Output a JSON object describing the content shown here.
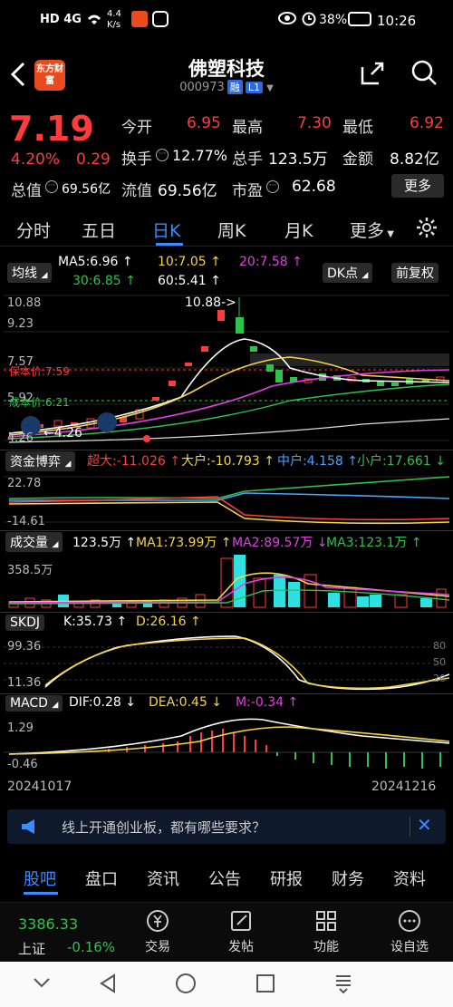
{
  "status": {
    "left_icons": "HD 4G",
    "speed": "4.4 K/s",
    "battery": "38%",
    "time": "10:26"
  },
  "header": {
    "logo_text": "东方财富",
    "title": "佛塑科技",
    "code": "000973",
    "badge1": "融",
    "badge2": "L1"
  },
  "quote": {
    "price": "7.19",
    "change_pct": "4.20%",
    "change": "0.29",
    "open_label": "今开",
    "open": "6.95",
    "high_label": "最高",
    "high": "7.30",
    "low_label": "最低",
    "low": "6.92",
    "turnover_label": "换手",
    "turnover": "12.77%",
    "total_hand_label": "总手",
    "total_hand": "123.5万",
    "amount_label": "金额",
    "amount": "8.82亿",
    "total_value_label": "总值",
    "total_value": "69.56亿",
    "float_value_label": "流值",
    "float_value": "69.56亿",
    "pe_label": "市盈",
    "pe": "62.68",
    "more": "更多"
  },
  "tabs": [
    "分时",
    "五日",
    "日K",
    "周K",
    "月K",
    "更多"
  ],
  "ma": {
    "label": "均线",
    "ma5": "MA5:6.96 ↑",
    "ma10": "10:7.05 ↑",
    "ma20": "20:7.58 ↑",
    "ma30": "30:6.85 ↑",
    "ma60": "60:5.41 ↑",
    "dk": "DK点",
    "adjust": "前复权"
  },
  "kline": {
    "y_top": "10.88",
    "y_2": "9.23",
    "y_3": "7.57",
    "y_4": "5.92",
    "y_bottom": "4.26",
    "high_mark": "10.88->",
    "low_mark": "←4.26",
    "stop_price": "保本价:7.59",
    "cost_price": "成本价:6.21"
  },
  "fund": {
    "label": "资金博弈",
    "super": "超大:-11.026 ↑",
    "big": "大户:-10.793 ↑",
    "mid": "中户:4.158 ↑",
    "small": "小户:17.661 ↓",
    "y_top": "22.78",
    "y_bottom": "-14.61"
  },
  "volume": {
    "label": "成交量",
    "vol": "123.5万 ↑",
    "ma1": "MA1:73.99万 ↑",
    "ma2": "MA2:89.57万 ↓",
    "ma3": "MA3:123.1万 ↑",
    "y_top": "358.5万"
  },
  "skdj": {
    "label": "SKDJ",
    "k": "K:35.73 ↑",
    "d": "D:26.16 ↑",
    "y_top": "99.36",
    "y_bottom": "11.36",
    "r80": "80",
    "r50": "50",
    "r20": "20"
  },
  "macd": {
    "label": "MACD",
    "dif": "DIF:0.28 ↓",
    "dea": "DEA:0.45 ↓",
    "m": "M:-0.34 ↑",
    "y_top": "1.29",
    "y_bottom": "-0.46"
  },
  "dates": {
    "start": "20241017",
    "end": "20241216"
  },
  "notice": "线上开通创业板，都有哪些要求？",
  "bottom_tabs": [
    "股吧",
    "盘口",
    "资讯",
    "公告",
    "研报",
    "财务",
    "资料"
  ],
  "toolbar": {
    "index_value": "3386.33",
    "index_name": "上证",
    "index_change": "-0.16%",
    "trade": "交易",
    "post": "发帖",
    "func": "功能",
    "watch": "设自选"
  },
  "colors": {
    "up": "#ff3b3b",
    "down": "#2fc24a",
    "accent": "#3b8bff"
  }
}
